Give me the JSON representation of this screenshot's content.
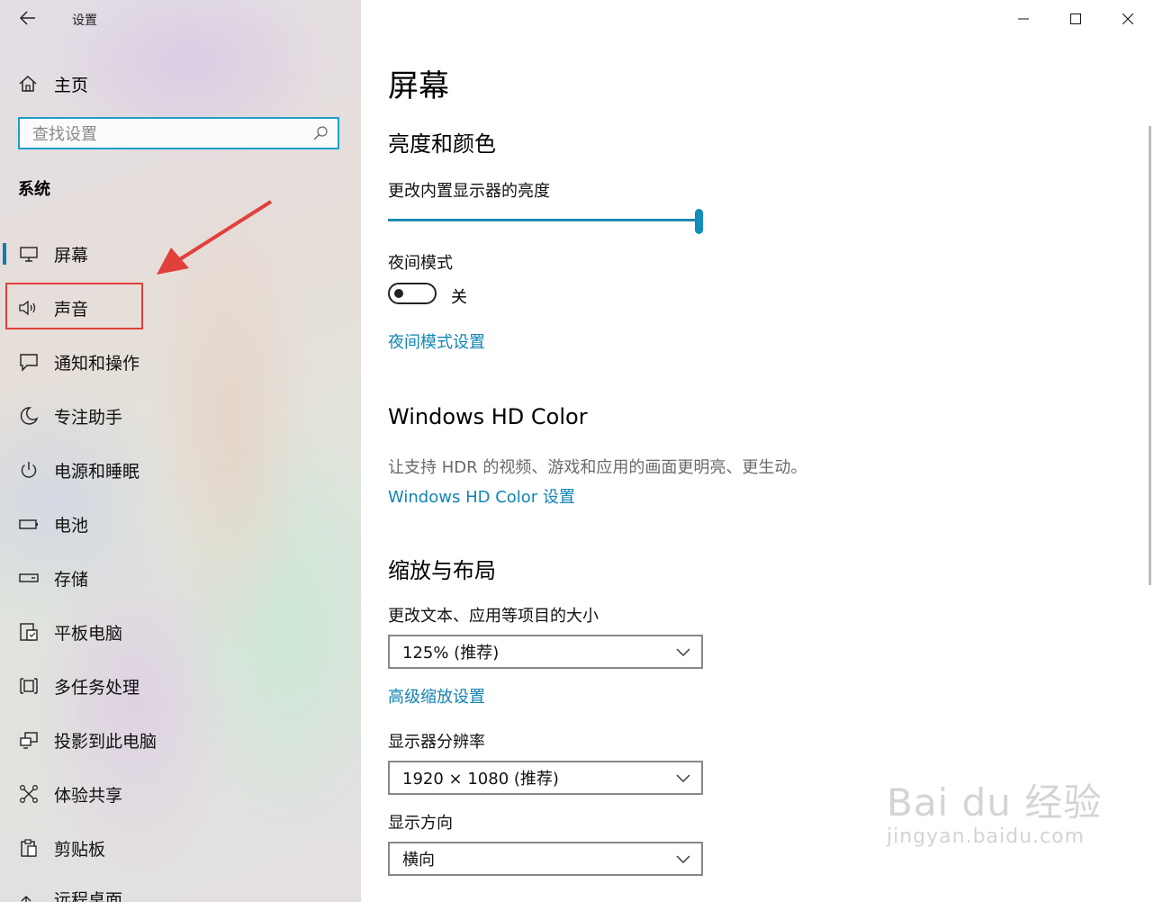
{
  "window": {
    "title": "设置"
  },
  "sidebar": {
    "home_label": "主页",
    "search_placeholder": "查找设置",
    "section_label": "系统",
    "items": [
      {
        "label": "屏幕",
        "icon": "monitor-icon",
        "active": true
      },
      {
        "label": "声音",
        "icon": "speaker-icon",
        "active": false
      },
      {
        "label": "通知和操作",
        "icon": "notification-icon",
        "active": false
      },
      {
        "label": "专注助手",
        "icon": "moon-icon",
        "active": false
      },
      {
        "label": "电源和睡眠",
        "icon": "power-icon",
        "active": false
      },
      {
        "label": "电池",
        "icon": "battery-icon",
        "active": false
      },
      {
        "label": "存储",
        "icon": "storage-icon",
        "active": false
      },
      {
        "label": "平板电脑",
        "icon": "tablet-icon",
        "active": false
      },
      {
        "label": "多任务处理",
        "icon": "multitask-icon",
        "active": false
      },
      {
        "label": "投影到此电脑",
        "icon": "projection-icon",
        "active": false
      },
      {
        "label": "体验共享",
        "icon": "share-icon",
        "active": false
      },
      {
        "label": "剪贴板",
        "icon": "clipboard-icon",
        "active": false
      },
      {
        "label": "远程桌面",
        "icon": "remote-desktop-icon",
        "active": false
      }
    ]
  },
  "main": {
    "page_title": "屏幕",
    "brightness": {
      "heading": "亮度和颜色",
      "label": "更改内置显示器的亮度",
      "value_percent": 100
    },
    "night_mode": {
      "label": "夜间模式",
      "state_label": "关",
      "on": false,
      "settings_link": "夜间模式设置"
    },
    "hd_color": {
      "heading": "Windows HD Color",
      "description": "让支持 HDR 的视频、游戏和应用的画面更明亮、更生动。",
      "link": "Windows HD Color 设置"
    },
    "scale_layout": {
      "heading": "缩放与布局",
      "scale_label": "更改文本、应用等项目的大小",
      "scale_value": "125% (推荐)",
      "advanced_link": "高级缩放设置",
      "resolution_label": "显示器分辨率",
      "resolution_value": "1920 × 1080 (推荐)",
      "orientation_label": "显示方向",
      "orientation_value": "横向"
    }
  },
  "watermark": {
    "main": "Bai du 经验",
    "sub": "jingyan.baidu.com"
  },
  "colors": {
    "accent": "#138dbb",
    "link": "#1284b3",
    "annotation": "#e2403b"
  }
}
